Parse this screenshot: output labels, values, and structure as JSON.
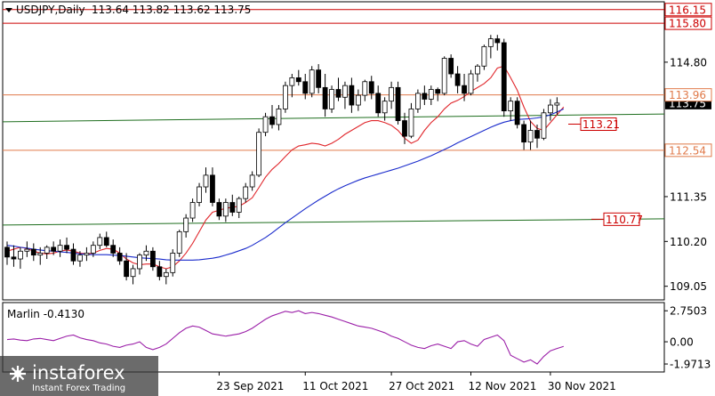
{
  "header": {
    "symbol_label": "USDJPY,Daily",
    "ohlc": "113.64 113.82 113.62 113.75"
  },
  "indicator": {
    "label": "Marlin -0.4130",
    "ticks": [
      "2.7503",
      "0.00",
      "-1.9713"
    ]
  },
  "watermark": {
    "brand": "instaforex",
    "tagline": "Instant Forex Trading"
  },
  "colors": {
    "bull": "#ffffff",
    "bear": "#000000",
    "ma_fast": "#e0262b",
    "ma_slow": "#1a2bcc",
    "trend": "#1e6e1e",
    "level_red": "#cc0000",
    "level_orange": "#e07a4a",
    "oscillator": "#9b1fa8"
  },
  "chart_data": {
    "type": "candlestick",
    "title": "USDJPY,Daily",
    "ylim": [
      108.7,
      116.35
    ],
    "y_ticks": [
      {
        "label": "109.05",
        "value": 109.05
      },
      {
        "label": "110.20",
        "value": 110.2
      },
      {
        "label": "111.35",
        "value": 111.35
      },
      {
        "label": "114.80",
        "value": 114.8
      }
    ],
    "x_ticks": [
      "23 Sep 2021",
      "11 Oct 2021",
      "27 Oct 2021",
      "12 Nov 2021",
      "30 Nov 2021"
    ],
    "x_tick_index": [
      32,
      45,
      58,
      70,
      82
    ],
    "current_price": {
      "label": "113.75",
      "value": 113.75
    },
    "levels": [
      {
        "label": "116.15",
        "value": 116.15,
        "style": "red-box"
      },
      {
        "label": "115.80",
        "value": 115.8,
        "style": "red-box"
      },
      {
        "label": "113.96",
        "value": 113.96,
        "style": "orange-box"
      },
      {
        "label": "112.54",
        "value": 112.54,
        "style": "orange-box"
      },
      {
        "label": "113.21",
        "value": 113.21,
        "style": "inline"
      },
      {
        "label": "110.77",
        "value": 110.77,
        "style": "inline"
      }
    ],
    "candles": [
      [
        110.05,
        110.2,
        109.6,
        109.8
      ],
      [
        109.8,
        110.1,
        109.55,
        109.75
      ],
      [
        109.75,
        110.05,
        109.5,
        109.95
      ],
      [
        109.95,
        110.2,
        109.8,
        110.0
      ],
      [
        110.0,
        110.15,
        109.7,
        109.85
      ],
      [
        109.85,
        110.05,
        109.6,
        109.9
      ],
      [
        109.9,
        110.1,
        109.75,
        110.05
      ],
      [
        110.05,
        110.2,
        109.85,
        109.95
      ],
      [
        109.95,
        110.25,
        109.8,
        110.1
      ],
      [
        110.1,
        110.3,
        109.9,
        110.0
      ],
      [
        110.0,
        110.15,
        109.6,
        109.7
      ],
      [
        109.7,
        109.95,
        109.55,
        109.85
      ],
      [
        109.85,
        110.05,
        109.7,
        109.9
      ],
      [
        109.9,
        110.2,
        109.8,
        110.1
      ],
      [
        110.1,
        110.4,
        110.0,
        110.3
      ],
      [
        110.3,
        110.45,
        110.05,
        110.1
      ],
      [
        110.1,
        110.25,
        109.8,
        109.9
      ],
      [
        109.9,
        110.05,
        109.6,
        109.7
      ],
      [
        109.7,
        109.9,
        109.2,
        109.3
      ],
      [
        109.3,
        109.6,
        109.1,
        109.5
      ],
      [
        109.5,
        109.9,
        109.35,
        109.85
      ],
      [
        109.85,
        110.1,
        109.7,
        109.95
      ],
      [
        109.95,
        110.05,
        109.45,
        109.55
      ],
      [
        109.55,
        109.7,
        109.2,
        109.3
      ],
      [
        109.3,
        109.5,
        109.1,
        109.4
      ],
      [
        109.4,
        110.0,
        109.3,
        109.9
      ],
      [
        109.9,
        110.5,
        109.8,
        110.45
      ],
      [
        110.45,
        110.9,
        110.3,
        110.8
      ],
      [
        110.8,
        111.3,
        110.7,
        111.2
      ],
      [
        111.2,
        111.7,
        111.1,
        111.6
      ],
      [
        111.6,
        112.1,
        111.45,
        111.9
      ],
      [
        111.9,
        112.1,
        111.1,
        111.2
      ],
      [
        111.2,
        111.3,
        110.75,
        110.85
      ],
      [
        110.85,
        111.3,
        110.7,
        111.2
      ],
      [
        111.2,
        111.4,
        110.85,
        110.95
      ],
      [
        110.95,
        111.35,
        110.8,
        111.3
      ],
      [
        111.3,
        111.7,
        111.2,
        111.6
      ],
      [
        111.6,
        112.0,
        111.5,
        111.9
      ],
      [
        111.9,
        113.1,
        111.85,
        113.0
      ],
      [
        113.0,
        113.5,
        112.9,
        113.4
      ],
      [
        113.4,
        113.7,
        113.1,
        113.2
      ],
      [
        113.2,
        113.7,
        113.05,
        113.6
      ],
      [
        113.6,
        114.3,
        113.5,
        114.2
      ],
      [
        114.2,
        114.5,
        113.9,
        114.4
      ],
      [
        114.4,
        114.6,
        114.2,
        114.3
      ],
      [
        114.3,
        114.5,
        113.85,
        114.0
      ],
      [
        114.0,
        114.7,
        113.9,
        114.6
      ],
      [
        114.6,
        114.75,
        114.0,
        114.15
      ],
      [
        114.15,
        114.5,
        113.4,
        113.6
      ],
      [
        113.6,
        114.2,
        113.5,
        114.1
      ],
      [
        114.1,
        114.4,
        113.8,
        113.9
      ],
      [
        113.9,
        114.3,
        113.6,
        114.2
      ],
      [
        114.2,
        114.4,
        113.5,
        113.7
      ],
      [
        113.7,
        114.1,
        113.55,
        113.95
      ],
      [
        113.95,
        114.35,
        113.8,
        114.3
      ],
      [
        114.3,
        114.45,
        113.85,
        114.0
      ],
      [
        114.0,
        114.2,
        113.4,
        113.5
      ],
      [
        113.5,
        113.9,
        113.3,
        113.8
      ],
      [
        113.8,
        114.3,
        113.6,
        114.15
      ],
      [
        114.15,
        114.3,
        113.2,
        113.3
      ],
      [
        113.3,
        113.5,
        112.7,
        112.9
      ],
      [
        112.9,
        113.75,
        112.85,
        113.6
      ],
      [
        113.6,
        114.1,
        113.5,
        114.0
      ],
      [
        114.0,
        114.2,
        113.7,
        113.85
      ],
      [
        113.85,
        114.2,
        113.7,
        114.1
      ],
      [
        114.1,
        114.15,
        113.8,
        114.0
      ],
      [
        114.0,
        114.95,
        113.95,
        114.9
      ],
      [
        114.9,
        115.0,
        114.4,
        114.5
      ],
      [
        114.5,
        114.7,
        114.0,
        114.2
      ],
      [
        114.2,
        114.5,
        113.8,
        114.0
      ],
      [
        114.0,
        114.6,
        113.95,
        114.5
      ],
      [
        114.5,
        114.75,
        114.3,
        114.7
      ],
      [
        114.7,
        115.25,
        114.6,
        115.2
      ],
      [
        115.2,
        115.5,
        114.9,
        115.4
      ],
      [
        115.4,
        115.5,
        115.1,
        115.3
      ],
      [
        115.3,
        115.4,
        113.4,
        113.55
      ],
      [
        113.55,
        113.9,
        113.3,
        113.8
      ],
      [
        113.8,
        113.9,
        113.1,
        113.2
      ],
      [
        113.2,
        113.3,
        112.55,
        112.75
      ],
      [
        112.75,
        113.3,
        112.55,
        113.05
      ],
      [
        113.05,
        113.2,
        112.6,
        112.85
      ],
      [
        112.85,
        113.6,
        112.8,
        113.5
      ],
      [
        113.5,
        113.85,
        113.3,
        113.7
      ],
      [
        113.7,
        113.9,
        113.45,
        113.75
      ]
    ],
    "series": [
      {
        "name": "",
        "color": "#e0262b",
        "values": [
          109.95,
          110.0,
          110.05,
          110.02,
          109.95,
          109.9,
          109.88,
          109.9,
          109.95,
          109.98,
          109.95,
          109.9,
          109.88,
          109.9,
          109.97,
          110.02,
          110.0,
          109.9,
          109.75,
          109.65,
          109.6,
          109.62,
          109.62,
          109.55,
          109.5,
          109.55,
          109.7,
          109.9,
          110.15,
          110.45,
          110.75,
          110.95,
          111.0,
          111.05,
          111.08,
          111.1,
          111.2,
          111.32,
          111.58,
          111.85,
          112.05,
          112.2,
          112.38,
          112.55,
          112.65,
          112.68,
          112.72,
          112.7,
          112.65,
          112.72,
          112.82,
          112.95,
          113.05,
          113.15,
          113.25,
          113.3,
          113.3,
          113.25,
          113.18,
          113.05,
          112.85,
          112.72,
          112.8,
          113.05,
          113.25,
          113.4,
          113.6,
          113.75,
          113.82,
          113.92,
          114.05,
          114.15,
          114.25,
          114.4,
          114.65,
          114.7,
          114.4,
          114.08,
          113.65,
          113.28,
          113.1,
          113.05,
          113.25,
          113.45,
          113.65
        ]
      },
      {
        "name": "",
        "color": "#1a2bcc",
        "values": [
          110.1,
          110.08,
          110.05,
          110.03,
          110.0,
          109.98,
          109.96,
          109.95,
          109.93,
          109.92,
          109.9,
          109.88,
          109.87,
          109.86,
          109.86,
          109.86,
          109.85,
          109.84,
          109.82,
          109.8,
          109.78,
          109.77,
          109.76,
          109.75,
          109.73,
          109.72,
          109.72,
          109.72,
          109.72,
          109.73,
          109.75,
          109.77,
          109.8,
          109.85,
          109.9,
          109.96,
          110.02,
          110.1,
          110.2,
          110.3,
          110.42,
          110.55,
          110.68,
          110.8,
          110.92,
          111.04,
          111.15,
          111.26,
          111.36,
          111.46,
          111.55,
          111.63,
          111.7,
          111.77,
          111.83,
          111.88,
          111.93,
          111.98,
          112.03,
          112.08,
          112.14,
          112.2,
          112.26,
          112.33,
          112.4,
          112.48,
          112.56,
          112.64,
          112.73,
          112.81,
          112.89,
          112.97,
          113.05,
          113.13,
          113.2,
          113.26,
          113.3,
          113.33,
          113.34,
          113.35,
          113.37,
          113.4,
          113.45,
          113.52,
          113.6
        ]
      }
    ],
    "trendlines": [
      {
        "x0": 0,
        "y0": 113.27,
        "x1": 100,
        "y1": 113.47
      },
      {
        "x0": 0,
        "y0": 110.62,
        "x1": 100,
        "y1": 110.78
      }
    ],
    "oscillator": {
      "label": "Marlin -0.4130",
      "ylim": [
        -2.6,
        3.4
      ],
      "values": [
        0.2,
        0.25,
        0.15,
        0.1,
        0.25,
        0.3,
        0.2,
        0.1,
        0.3,
        0.5,
        0.6,
        0.35,
        0.2,
        0.1,
        -0.1,
        -0.2,
        -0.4,
        -0.5,
        -0.3,
        -0.2,
        0.0,
        -0.5,
        -0.7,
        -0.5,
        -0.2,
        0.3,
        0.8,
        1.2,
        1.4,
        1.3,
        1.0,
        0.7,
        0.6,
        0.5,
        0.6,
        0.7,
        0.9,
        1.2,
        1.6,
        2.0,
        2.3,
        2.5,
        2.7,
        2.6,
        2.75,
        2.5,
        2.6,
        2.5,
        2.35,
        2.2,
        2.0,
        1.8,
        1.6,
        1.4,
        1.3,
        1.2,
        1.0,
        0.8,
        0.5,
        0.3,
        0.0,
        -0.3,
        -0.5,
        -0.6,
        -0.35,
        -0.2,
        -0.4,
        -0.6,
        0.0,
        0.1,
        -0.2,
        -0.4,
        0.2,
        0.4,
        0.6,
        0.1,
        -1.2,
        -1.5,
        -1.8,
        -1.6,
        -1.97,
        -1.3,
        -0.8,
        -0.6,
        -0.41
      ]
    }
  }
}
